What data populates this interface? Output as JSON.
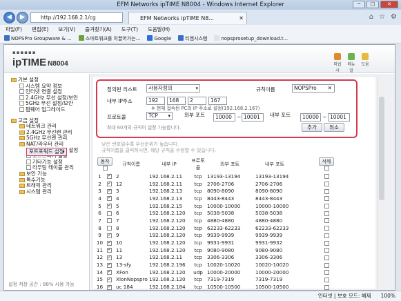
{
  "window": {
    "title": "EFM Networks ipTIME N8004 - Windows Internet Explorer",
    "controls": [
      "─",
      "□",
      "✕"
    ]
  },
  "browser": {
    "url": "http://192.168.2.1/cg",
    "tab_title": "EFM Networks ipTIME N8...",
    "tab_close": "✕",
    "top_icons": [
      "⌂",
      "☆",
      "⚙"
    ],
    "menu": [
      "파일(F)",
      "편집(E)",
      "보기(V)",
      "즐겨찾기(A)",
      "도구(T)",
      "도움말(H)"
    ],
    "favorites": [
      {
        "label": "NOPSPro Groupware & ...",
        "color": "#3a6fc4"
      },
      {
        "label": "스마트워크를 이끌어가는...",
        "color": "#6aa33a"
      },
      {
        "label": "Google",
        "color": "#2d6ed8"
      },
      {
        "label": "티엠시스템",
        "color": "#3a6fc4"
      },
      {
        "label": "nopsprosetup_download.t...",
        "color": "#dfe3e8"
      }
    ]
  },
  "router": {
    "logo_dots": "▪▪▪▪▪▪",
    "logo_main": "ipTIME",
    "logo_model": "N8004",
    "header_icons": [
      {
        "label": "마법사",
        "color": "#e08b2a"
      },
      {
        "label": "메뉴얼",
        "color": "#6bb34a"
      },
      {
        "label": "도움",
        "color": "#e8b93a"
      }
    ],
    "menu_tree": [
      {
        "type": "l1",
        "icon": "fo",
        "label": "기본 설정"
      },
      {
        "type": "l2",
        "icon": "fi",
        "label": "시스템 요약 정보"
      },
      {
        "type": "l2",
        "icon": "fi",
        "label": "인터넷 연결 설정"
      },
      {
        "type": "l2",
        "icon": "fi",
        "label": "2.4GHz 무선 설정/보안"
      },
      {
        "type": "l2",
        "icon": "fi",
        "label": "5GHz 무선 설정/보안"
      },
      {
        "type": "l2",
        "icon": "fi",
        "label": "펌웨어 업그레이드"
      },
      {
        "type": "gap"
      },
      {
        "type": "l1",
        "icon": "fo",
        "label": "고급 설정"
      },
      {
        "type": "l2",
        "icon": "fo",
        "label": "네트워크 관리"
      },
      {
        "type": "l2",
        "icon": "fo",
        "label": "2.4GHz 무선랜 관리"
      },
      {
        "type": "l2",
        "icon": "fo",
        "label": "5GHz 무선랜 관리"
      },
      {
        "type": "l2",
        "icon": "fo",
        "label": "NAT/라우터 관리"
      },
      {
        "type": "sel",
        "label": "포트포워드 설정"
      },
      {
        "type": "l3",
        "icon": "fi",
        "label": "DMZ / Twin IP 설정"
      },
      {
        "type": "l3",
        "icon": "fi",
        "label": "포트트리거 설정"
      },
      {
        "type": "l3",
        "icon": "fi",
        "label": "기타기능 설정"
      },
      {
        "type": "l3",
        "icon": "fi",
        "label": "라우팅 테이블 관리"
      },
      {
        "type": "l2",
        "icon": "fo",
        "label": "보안 기능"
      },
      {
        "type": "l2",
        "icon": "fo",
        "label": "특수기능"
      },
      {
        "type": "l2",
        "icon": "fo",
        "label": "트래픽 관리"
      },
      {
        "type": "l2",
        "icon": "fo",
        "label": "시스템 관리"
      }
    ],
    "storage_text": "설정 저장 공간 : 88% 사용 가능"
  },
  "form": {
    "rule_list_label": "정의된 리스트",
    "rule_list_value": "사용자정의",
    "rule_name_label": "규칙이름",
    "rule_name_value": "NOPSPro",
    "clear_icon": "✕",
    "internal_ip_label": "내부 IP주소",
    "ip": [
      "192",
      "168",
      "2",
      "167"
    ],
    "ip_note": "※ 현재 접속된 PC의 IP 주소로 설정(192.168.2.167)",
    "protocol_label": "프로토콜",
    "protocol_value": "TCP",
    "ext_port_label": "외부 포트",
    "ext_port_from": "10000",
    "ext_port_to": "10001",
    "int_port_label": "내부 포트",
    "int_port_from": "10000",
    "int_port_to": "10001",
    "tilde": "~",
    "add_button": "추가",
    "cancel_button": "취소",
    "max_note": "최대 60개의 규칙이 설정 가능합니다."
  },
  "info": {
    "line1": "낮은 번호일수록 우선순위가 높습니다.",
    "line2": "규칙이름을 클릭하시면, 해당 규칙을 수정할 수 있습니다."
  },
  "table": {
    "headers": {
      "run": "동작",
      "name": "규칙이름",
      "ip": "내부 IP",
      "proto": "프로토콜",
      "ext": "외부 포트",
      "int": "내부 포트",
      "del": "삭제"
    },
    "rows": [
      {
        "no": "1",
        "on": true,
        "name": "2",
        "ip": "192.168.2.11",
        "proto": "tcp",
        "ext": "13193-13194",
        "int": "13193-13194"
      },
      {
        "no": "2",
        "on": true,
        "name": "12",
        "ip": "192.168.2.11",
        "proto": "tcp",
        "ext": "2706-2706",
        "int": "2706-2706"
      },
      {
        "no": "3",
        "on": true,
        "name": "3",
        "ip": "192.168.2.13",
        "proto": "tcp",
        "ext": "8090-8090",
        "int": "8090-8090"
      },
      {
        "no": "4",
        "on": true,
        "name": "4",
        "ip": "192.168.2.13",
        "proto": "tcp",
        "ext": "8443-8443",
        "int": "8443-8443"
      },
      {
        "no": "5",
        "on": true,
        "name": "5",
        "ip": "192.168.2.15",
        "proto": "tcp",
        "ext": "10000-10000",
        "int": "10000-10000"
      },
      {
        "no": "6",
        "on": false,
        "name": "6",
        "ip": "192.168.2.120",
        "proto": "tcp",
        "ext": "5038-5038",
        "int": "5038-5038"
      },
      {
        "no": "7",
        "on": false,
        "name": "7",
        "ip": "192.168.2.120",
        "proto": "tcp",
        "ext": "4880-4880",
        "int": "4880-4880"
      },
      {
        "no": "8",
        "on": false,
        "name": "8",
        "ip": "192.168.2.120",
        "proto": "tcp",
        "ext": "62233-62233",
        "int": "62233-62233"
      },
      {
        "no": "9",
        "on": true,
        "name": "9",
        "ip": "192.168.2.120",
        "proto": "tcp",
        "ext": "9939-9939",
        "int": "9939-9939"
      },
      {
        "no": "10",
        "on": true,
        "name": "10",
        "ip": "192.168.2.120",
        "proto": "tcp",
        "ext": "9931-9931",
        "int": "9931-9932"
      },
      {
        "no": "11",
        "on": true,
        "name": "11",
        "ip": "192.168.2.120",
        "proto": "tcp",
        "ext": "9080-9080",
        "int": "9080-9080"
      },
      {
        "no": "12",
        "on": true,
        "name": "13",
        "ip": "192.168.2.11",
        "proto": "tcp",
        "ext": "3306-3306",
        "int": "3306-3306"
      },
      {
        "no": "13",
        "on": true,
        "name": "13-sfy",
        "ip": "192.168.2.196",
        "proto": "tcp",
        "ext": "10020-10020",
        "int": "10020-10020"
      },
      {
        "no": "14",
        "on": true,
        "name": "XFon",
        "ip": "192.168.2.120",
        "proto": "udp",
        "ext": "10000-20000",
        "int": "10000-20000"
      },
      {
        "no": "15",
        "on": true,
        "name": "XlonNopspro",
        "ip": "192.168.2.120",
        "proto": "tcp",
        "ext": "7319-7319",
        "int": "7319-7319"
      },
      {
        "no": "16",
        "on": true,
        "name": "uc 184",
        "ip": "192.168.2.184",
        "proto": "tcp",
        "ext": "10500-10500",
        "int": "10500-10500"
      }
    ]
  },
  "status": {
    "zone": "인터넷 | 보호 모드: 해제",
    "zoom": "100%"
  }
}
